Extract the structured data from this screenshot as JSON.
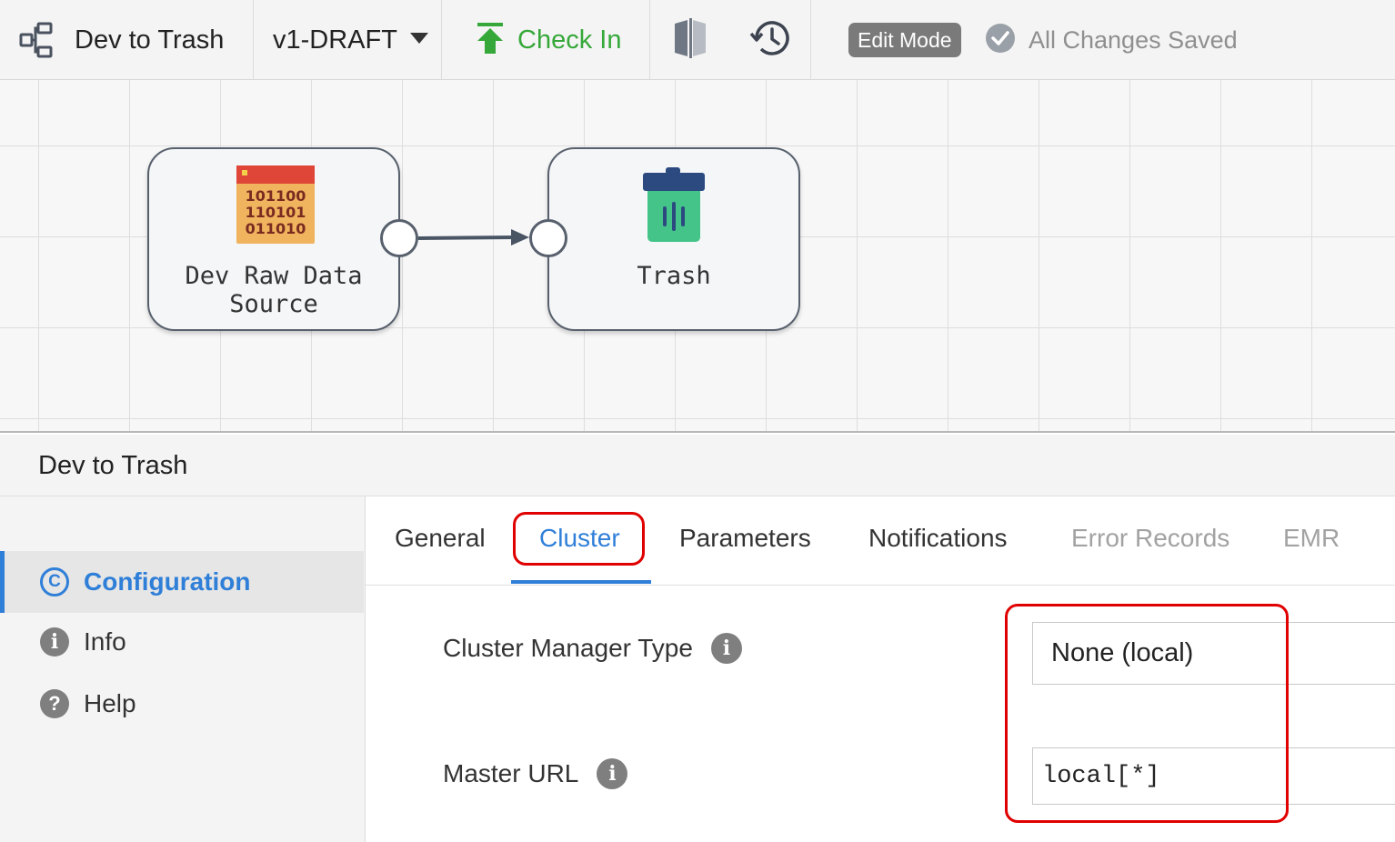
{
  "toolbar": {
    "pipeline_title": "Dev to Trash",
    "version": "v1-DRAFT",
    "check_in": "Check In",
    "edit_mode": "Edit Mode",
    "save_status": "All Changes Saved"
  },
  "canvas": {
    "stages": [
      {
        "label_line1": "Dev Raw Data",
        "label_line2": "Source",
        "icon": "binary-data-icon"
      },
      {
        "label_line1": "Trash",
        "icon": "trash-icon"
      }
    ]
  },
  "panel": {
    "title": "Dev to Trash",
    "nav": [
      {
        "label": "Configuration",
        "icon": "configuration-icon",
        "active": true
      },
      {
        "label": "Info",
        "icon": "info-icon"
      },
      {
        "label": "Help",
        "icon": "help-icon"
      }
    ],
    "tabs": [
      "General",
      "Cluster",
      "Parameters",
      "Notifications",
      "Error Records",
      "EMR"
    ],
    "active_tab": "Cluster",
    "fields": {
      "cluster_manager_type": {
        "label": "Cluster Manager Type",
        "value": "None (local)"
      },
      "master_url": {
        "label": "Master URL",
        "value": "local[*]"
      }
    }
  },
  "colors": {
    "accent": "#2f7fd8",
    "check_in": "#35a839",
    "highlight": "#e00000"
  }
}
